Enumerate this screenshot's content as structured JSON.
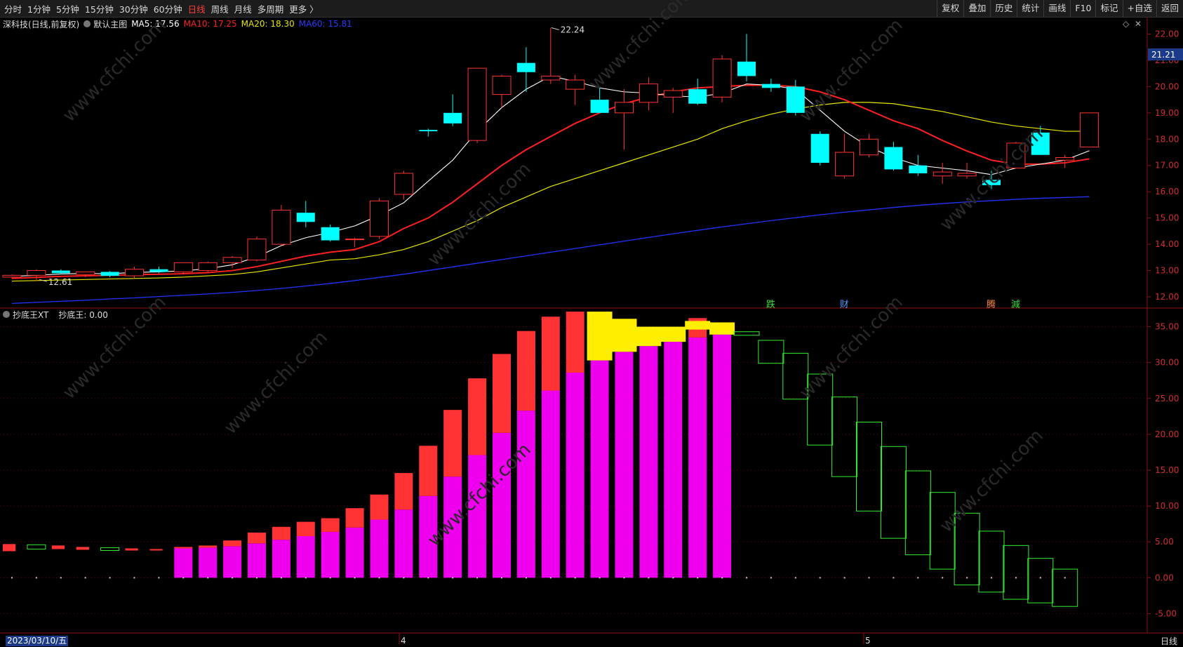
{
  "toolbar": {
    "periods": [
      {
        "label": "分时",
        "active": false
      },
      {
        "label": "1分钟",
        "active": false
      },
      {
        "label": "5分钟",
        "active": false
      },
      {
        "label": "15分钟",
        "active": false
      },
      {
        "label": "30分钟",
        "active": false
      },
      {
        "label": "60分钟",
        "active": false
      },
      {
        "label": "日线",
        "active": true
      },
      {
        "label": "周线",
        "active": false
      },
      {
        "label": "月线",
        "active": false
      },
      {
        "label": "多周期",
        "active": false
      },
      {
        "label": "更多 〉",
        "active": false
      }
    ],
    "right": [
      "复权",
      "叠加",
      "历史",
      "统计",
      "画线",
      "F10",
      "标记",
      "+自选",
      "返回"
    ]
  },
  "main_info": {
    "stock": "深科技(日线,前复权)",
    "chart_name": "默认主图",
    "ma5": "MA5: 17.56",
    "ma10": "MA10: 17.25",
    "ma20": "MA20: 18.30",
    "ma60": "MA60: 15.81",
    "max_label": "22.24",
    "min_label": "12.61",
    "current_price": "21.21"
  },
  "indicator_info": {
    "name": "抄底王XT",
    "value": "抄底王: 0.00"
  },
  "footer": {
    "date": "2023/03/10/五",
    "month_4": "4",
    "month_5": "5",
    "period": "日线"
  },
  "signals": [
    {
      "text": "跌",
      "color": "#33dd33",
      "idx": 31
    },
    {
      "text": "财",
      "color": "#5599ff",
      "idx": 34
    },
    {
      "text": "腾",
      "color": "#ff8844",
      "idx": 40
    },
    {
      "text": "減",
      "color": "#33dd33",
      "idx": 41
    }
  ],
  "colors": {
    "up": "#ff3333",
    "down": "#00ffff",
    "ma5": "#ffffff",
    "ma10": "#ff2020",
    "ma20": "#e6e600",
    "ma60": "#2233ff",
    "magenta": "#ee00ee",
    "yellow": "#ffee00",
    "green": "#33ee33"
  },
  "chart_data": [
    {
      "type": "candlestick",
      "title": "深科技(日线,前复权)",
      "y_ticks": [
        "22.00",
        "21.00",
        "20.00",
        "19.00",
        "18.00",
        "17.00",
        "16.00",
        "15.00",
        "14.00",
        "13.00",
        "12.00"
      ],
      "ylim": [
        11.6,
        22.6
      ],
      "ohlc": [
        [
          12.75,
          12.85,
          12.7,
          12.82
        ],
        [
          12.82,
          13.05,
          12.61,
          13.0
        ],
        [
          13.0,
          13.05,
          12.85,
          12.9
        ],
        [
          12.85,
          12.95,
          12.75,
          12.95
        ],
        [
          12.95,
          12.98,
          12.75,
          12.8
        ],
        [
          12.8,
          13.15,
          12.7,
          13.05
        ],
        [
          13.05,
          13.15,
          12.9,
          12.95
        ],
        [
          12.95,
          13.25,
          12.85,
          13.3
        ],
        [
          13.0,
          13.35,
          12.95,
          13.3
        ],
        [
          13.3,
          13.55,
          13.1,
          13.5
        ],
        [
          13.4,
          14.3,
          13.35,
          14.2
        ],
        [
          14.0,
          15.5,
          13.95,
          15.3
        ],
        [
          15.2,
          15.65,
          14.65,
          14.85
        ],
        [
          14.65,
          14.75,
          14.1,
          14.15
        ],
        [
          14.2,
          14.25,
          13.9,
          14.2
        ],
        [
          14.3,
          15.75,
          14.2,
          15.65
        ],
        [
          15.9,
          16.8,
          15.7,
          16.7
        ],
        [
          18.35,
          18.4,
          18.1,
          18.3
        ],
        [
          19.0,
          19.7,
          18.5,
          18.6
        ],
        [
          17.95,
          20.7,
          17.85,
          20.7
        ],
        [
          19.7,
          20.45,
          19.2,
          20.4
        ],
        [
          20.9,
          21.5,
          19.8,
          20.55
        ],
        [
          20.25,
          22.24,
          20.1,
          20.4
        ],
        [
          19.9,
          20.45,
          19.3,
          20.25
        ],
        [
          19.5,
          20.0,
          19.0,
          19.0
        ],
        [
          19.0,
          19.9,
          17.6,
          19.4
        ],
        [
          19.4,
          20.35,
          19.1,
          20.1
        ],
        [
          19.6,
          19.95,
          19.0,
          19.85
        ],
        [
          19.9,
          20.3,
          19.3,
          19.35
        ],
        [
          19.6,
          21.2,
          19.4,
          21.05
        ],
        [
          20.95,
          22.0,
          20.2,
          20.4
        ],
        [
          20.1,
          20.3,
          19.8,
          19.95
        ],
        [
          20.0,
          20.25,
          18.9,
          19.0
        ],
        [
          18.2,
          18.3,
          17.0,
          17.1
        ],
        [
          16.6,
          18.2,
          16.5,
          17.5
        ],
        [
          17.4,
          18.2,
          17.3,
          18.0
        ],
        [
          17.7,
          17.9,
          16.8,
          16.85
        ],
        [
          17.0,
          17.4,
          16.6,
          16.7
        ],
        [
          16.6,
          17.1,
          16.3,
          16.75
        ],
        [
          16.6,
          17.1,
          16.5,
          16.7
        ],
        [
          16.45,
          16.8,
          16.1,
          16.25
        ],
        [
          16.9,
          17.9,
          16.9,
          17.85
        ],
        [
          18.25,
          18.5,
          17.4,
          17.4
        ],
        [
          17.2,
          17.4,
          16.9,
          17.3
        ],
        [
          17.7,
          19.0,
          17.7,
          19.0
        ]
      ],
      "ma5": [
        12.78,
        12.82,
        12.87,
        12.89,
        12.88,
        12.93,
        12.95,
        12.99,
        13.07,
        13.22,
        13.52,
        13.95,
        14.25,
        14.45,
        14.7,
        15.1,
        15.58,
        16.4,
        17.2,
        18.3,
        19.2,
        19.9,
        20.4,
        20.2,
        19.95,
        19.8,
        19.75,
        19.65,
        19.6,
        19.75,
        20.1,
        20.05,
        19.9,
        19.1,
        18.3,
        17.7,
        17.3,
        17.0,
        16.9,
        16.8,
        16.65,
        16.9,
        17.05,
        17.2,
        17.56
      ],
      "ma10": [
        12.7,
        12.74,
        12.78,
        12.8,
        12.82,
        12.84,
        12.86,
        12.88,
        12.92,
        13.0,
        13.15,
        13.35,
        13.55,
        13.7,
        13.8,
        14.1,
        14.6,
        15.0,
        15.6,
        16.3,
        17.0,
        17.6,
        18.1,
        18.6,
        19.0,
        19.35,
        19.6,
        19.8,
        19.95,
        20.0,
        20.05,
        20.05,
        20.0,
        19.8,
        19.5,
        19.1,
        18.7,
        18.4,
        17.95,
        17.55,
        17.2,
        17.05,
        17.05,
        17.1,
        17.25
      ],
      "ma20": [
        12.6,
        12.62,
        12.64,
        12.66,
        12.68,
        12.7,
        12.72,
        12.75,
        12.8,
        12.85,
        12.95,
        13.1,
        13.25,
        13.4,
        13.45,
        13.6,
        13.8,
        14.1,
        14.5,
        14.9,
        15.4,
        15.8,
        16.2,
        16.5,
        16.8,
        17.1,
        17.4,
        17.7,
        18.0,
        18.4,
        18.7,
        18.95,
        19.15,
        19.3,
        19.4,
        19.4,
        19.35,
        19.2,
        19.05,
        18.85,
        18.65,
        18.5,
        18.4,
        18.3,
        18.3
      ],
      "ma60": [
        11.75,
        11.79,
        11.83,
        11.87,
        11.92,
        11.96,
        12.01,
        12.06,
        12.11,
        12.17,
        12.24,
        12.32,
        12.41,
        12.51,
        12.62,
        12.74,
        12.86,
        13.0,
        13.14,
        13.28,
        13.42,
        13.56,
        13.7,
        13.84,
        13.98,
        14.12,
        14.26,
        14.4,
        14.53,
        14.66,
        14.78,
        14.9,
        15.01,
        15.12,
        15.22,
        15.31,
        15.4,
        15.48,
        15.55,
        15.61,
        15.66,
        15.71,
        15.75,
        15.78,
        15.81
      ]
    },
    {
      "type": "bar",
      "title": "抄底王XT",
      "y_ticks": [
        "35.00",
        "30.00",
        "25.00",
        "20.00",
        "15.00",
        "10.00",
        "5.00",
        "0.00",
        "-5.00"
      ],
      "ylim": [
        -7.5,
        37.5
      ],
      "series": [
        {
          "name": "抄底王",
          "kind": "small_bars",
          "values": [
            [
              0,
              3.7,
              4.7,
              "#ff3333",
              true
            ],
            [
              1,
              4.0,
              4.6,
              "#33ee33",
              false
            ],
            [
              2,
              4.0,
              4.5,
              "#ff3333",
              true
            ],
            [
              3,
              3.9,
              4.3,
              "#ff3333",
              true
            ],
            [
              4,
              3.8,
              4.2,
              "#33ee33",
              false
            ],
            [
              5,
              3.8,
              4.1,
              "#ff3333",
              true
            ],
            [
              6,
              3.8,
              4.0,
              "#ff3333",
              true
            ]
          ]
        },
        {
          "name": "magenta",
          "kind": "column",
          "values": [
            [
              7,
              0,
              4.1
            ],
            [
              8,
              0,
              4.2
            ],
            [
              9,
              0,
              4.4
            ],
            [
              10,
              0,
              4.8
            ],
            [
              11,
              0,
              5.3
            ],
            [
              12,
              0,
              5.8
            ],
            [
              13,
              0,
              6.4
            ],
            [
              14,
              0,
              7.0
            ],
            [
              15,
              0,
              8.1
            ],
            [
              16,
              0,
              9.5
            ],
            [
              17,
              0,
              11.4
            ],
            [
              18,
              0,
              14.1
            ],
            [
              19,
              0,
              17.1
            ],
            [
              20,
              0,
              20.2
            ],
            [
              21,
              0,
              23.3
            ],
            [
              22,
              0,
              26.1
            ],
            [
              23,
              0,
              28.6
            ],
            [
              24,
              0,
              30.3
            ],
            [
              25,
              0,
              31.5
            ],
            [
              26,
              0,
              32.3
            ],
            [
              27,
              0,
              32.9
            ],
            [
              28,
              0,
              33.5
            ],
            [
              29,
              0,
              33.9
            ]
          ]
        },
        {
          "name": "red",
          "kind": "column",
          "values": [
            [
              7,
              4.1,
              4.3
            ],
            [
              8,
              4.2,
              4.5
            ],
            [
              9,
              4.4,
              5.2
            ],
            [
              10,
              4.8,
              6.3
            ],
            [
              11,
              5.3,
              7.1
            ],
            [
              12,
              5.8,
              7.8
            ],
            [
              13,
              6.4,
              8.3
            ],
            [
              14,
              7.0,
              9.7
            ],
            [
              15,
              8.1,
              11.6
            ],
            [
              16,
              9.5,
              14.6
            ],
            [
              17,
              11.4,
              18.4
            ],
            [
              18,
              14.1,
              23.4
            ],
            [
              19,
              17.1,
              27.8
            ],
            [
              20,
              20.2,
              31.2
            ],
            [
              21,
              23.3,
              34.4
            ],
            [
              22,
              26.1,
              36.4
            ],
            [
              23,
              28.6,
              37.1
            ],
            [
              28,
              33.5,
              36.2
            ]
          ]
        },
        {
          "name": "yellow",
          "kind": "column",
          "values": [
            [
              24,
              30.3,
              37.1
            ],
            [
              25,
              31.5,
              36.1
            ],
            [
              26,
              32.3,
              35.0
            ],
            [
              27,
              32.9,
              35.0
            ],
            [
              28,
              34.6,
              35.8
            ],
            [
              29,
              33.9,
              35.6
            ]
          ]
        },
        {
          "name": "green_outline",
          "kind": "outline",
          "values": [
            [
              30,
              33.8,
              34.3
            ],
            [
              31,
              29.9,
              33.1
            ],
            [
              32,
              24.9,
              31.3
            ],
            [
              33,
              18.5,
              28.4
            ],
            [
              34,
              14.1,
              25.2
            ],
            [
              35,
              9.3,
              21.7
            ],
            [
              36,
              5.5,
              18.3
            ],
            [
              37,
              3.2,
              14.9
            ],
            [
              38,
              1.2,
              11.9
            ],
            [
              39,
              -1.0,
              9.0
            ],
            [
              40,
              -2.0,
              6.5
            ],
            [
              41,
              -3.0,
              4.5
            ],
            [
              42,
              -3.5,
              2.7
            ],
            [
              43,
              -4.0,
              1.2
            ]
          ]
        }
      ]
    }
  ]
}
